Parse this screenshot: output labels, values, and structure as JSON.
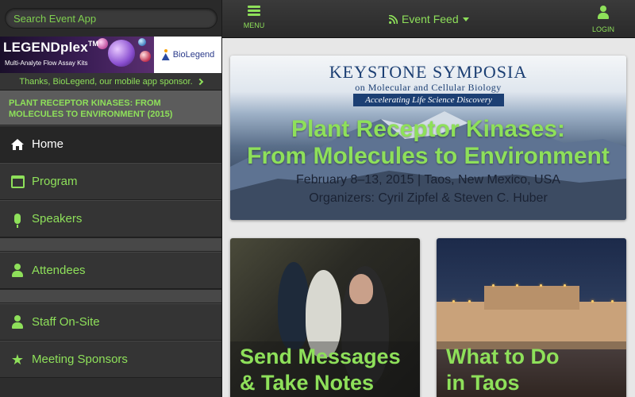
{
  "search": {
    "placeholder": "Search Event App"
  },
  "sponsor": {
    "banner_title": "LEGENDplex",
    "banner_tm": "TM",
    "banner_subtitle": "Multi-Analyte Flow Assay Kits",
    "banner_brand": "BioLegend",
    "thanks_text": "Thanks, BioLegend, our mobile app sponsor."
  },
  "event": {
    "title": "PLANT RECEPTOR KINASES: FROM MOLECULES TO ENVIRONMENT (2015)"
  },
  "nav": {
    "items": [
      {
        "label": "Home",
        "icon": "home-icon",
        "active": true
      },
      {
        "label": "Program",
        "icon": "calendar-icon"
      },
      {
        "label": "Speakers",
        "icon": "microphone-icon"
      },
      {
        "label": "Attendees",
        "icon": "user-icon"
      },
      {
        "label": "Staff On-Site",
        "icon": "user-icon"
      },
      {
        "label": "Meeting Sponsors",
        "icon": "star-icon"
      }
    ]
  },
  "topbar": {
    "menu_label": "MENU",
    "feed_label": "Event Feed",
    "login_label": "LOGIN"
  },
  "hero": {
    "org_name": "KEYSTONE SYMPOSIA",
    "org_sub": "on Molecular and Cellular Biology",
    "tagline": "Accelerating Life Science Discovery",
    "title_line1": "Plant Receptor Kinases:",
    "title_line2": "From Molecules to Environment",
    "dates": "February 8–13, 2015 | Taos, New Mexico, USA",
    "organizers": "Organizers: Cyril Zipfel & Steven C. Huber"
  },
  "cards": [
    {
      "line1": "Send Messages",
      "line2": "& Take Notes"
    },
    {
      "line1": "What to Do",
      "line2": "in Taos"
    }
  ],
  "colors": {
    "accent": "#8ee05a",
    "sidebar_bg": "#2d2d2d",
    "content_bg": "#e7e7e7",
    "keystone_blue": "#1c3f73"
  }
}
